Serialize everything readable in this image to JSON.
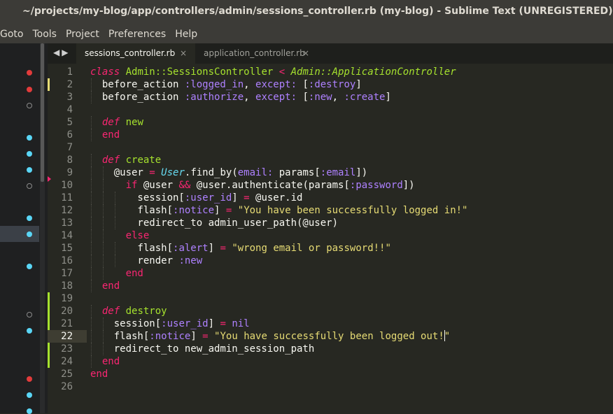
{
  "window": {
    "title": "~/projects/my-blog/app/controllers/admin/sessions_controller.rb (my-blog) - Sublime Text (UNREGISTERED)"
  },
  "menu": [
    "Goto",
    "Tools",
    "Project",
    "Preferences",
    "Help"
  ],
  "tabs": [
    {
      "label": "sessions_controller.rb",
      "active": true,
      "close": "×"
    },
    {
      "label": "application_controller.rb",
      "active": false,
      "close": "×"
    }
  ],
  "nav": {
    "back": "◀",
    "forward": "▶"
  },
  "editor": {
    "current_line": 22,
    "line_numbers": [
      "1",
      "2",
      "3",
      "4",
      "5",
      "6",
      "7",
      "8",
      "9",
      "10",
      "11",
      "12",
      "13",
      "14",
      "15",
      "16",
      "17",
      "18",
      "19",
      "20",
      "21",
      "22",
      "23",
      "24",
      "25",
      "26"
    ],
    "lines": [
      [
        [
          "kwi",
          "class"
        ],
        [
          "plain",
          " "
        ],
        [
          "cls",
          "Admin::SessionsController"
        ],
        [
          "plain",
          " "
        ],
        [
          "op",
          "<"
        ],
        [
          "plain",
          " "
        ],
        [
          "clsi",
          "Admin::ApplicationController"
        ]
      ],
      [
        [
          "plain",
          "  before_action "
        ],
        [
          "sym",
          ":logged_in"
        ],
        [
          "plain",
          ", "
        ],
        [
          "sym",
          "except:"
        ],
        [
          "plain",
          " ["
        ],
        [
          "sym",
          ":destroy"
        ],
        [
          "plain",
          "]"
        ]
      ],
      [
        [
          "plain",
          "  before_action "
        ],
        [
          "sym",
          ":authorize"
        ],
        [
          "plain",
          ", "
        ],
        [
          "sym",
          "except:"
        ],
        [
          "plain",
          " ["
        ],
        [
          "sym",
          ":new"
        ],
        [
          "plain",
          ", "
        ],
        [
          "sym",
          ":create"
        ],
        [
          "plain",
          "]"
        ]
      ],
      [
        [
          "plain",
          ""
        ]
      ],
      [
        [
          "plain",
          "  "
        ],
        [
          "kwi",
          "def"
        ],
        [
          "plain",
          " "
        ],
        [
          "fn",
          "new"
        ]
      ],
      [
        [
          "plain",
          "  "
        ],
        [
          "kw",
          "end"
        ]
      ],
      [
        [
          "plain",
          ""
        ]
      ],
      [
        [
          "plain",
          "  "
        ],
        [
          "kwi",
          "def"
        ],
        [
          "plain",
          " "
        ],
        [
          "fn",
          "create"
        ]
      ],
      [
        [
          "plain",
          "    @user "
        ],
        [
          "op",
          "="
        ],
        [
          "plain",
          " "
        ],
        [
          "ty",
          "User"
        ],
        [
          "plain",
          ".find_by("
        ],
        [
          "sym",
          "email:"
        ],
        [
          "plain",
          " params["
        ],
        [
          "sym",
          ":email"
        ],
        [
          "plain",
          "])"
        ]
      ],
      [
        [
          "plain",
          "      "
        ],
        [
          "kw",
          "if"
        ],
        [
          "plain",
          " @user "
        ],
        [
          "op",
          "&&"
        ],
        [
          "plain",
          " @user.authenticate(params["
        ],
        [
          "sym",
          ":password"
        ],
        [
          "plain",
          "])"
        ]
      ],
      [
        [
          "plain",
          "        session["
        ],
        [
          "sym",
          ":user_id"
        ],
        [
          "plain",
          "] "
        ],
        [
          "op",
          "="
        ],
        [
          "plain",
          " @user.id"
        ]
      ],
      [
        [
          "plain",
          "        flash["
        ],
        [
          "sym",
          ":notice"
        ],
        [
          "plain",
          "] "
        ],
        [
          "op",
          "="
        ],
        [
          "plain",
          " "
        ],
        [
          "str",
          "\"You have been successfully logged in!\""
        ]
      ],
      [
        [
          "plain",
          "        redirect_to admin_user_path(@user)"
        ]
      ],
      [
        [
          "plain",
          "      "
        ],
        [
          "kw",
          "else"
        ]
      ],
      [
        [
          "plain",
          "        flash["
        ],
        [
          "sym",
          ":alert"
        ],
        [
          "plain",
          "] "
        ],
        [
          "op",
          "="
        ],
        [
          "plain",
          " "
        ],
        [
          "str",
          "\"wrong email or password!!\""
        ]
      ],
      [
        [
          "plain",
          "        render "
        ],
        [
          "sym",
          ":new"
        ]
      ],
      [
        [
          "plain",
          "      "
        ],
        [
          "kw",
          "end"
        ]
      ],
      [
        [
          "plain",
          "  "
        ],
        [
          "kw",
          "end"
        ]
      ],
      [
        [
          "plain",
          ""
        ]
      ],
      [
        [
          "plain",
          "  "
        ],
        [
          "kwi",
          "def"
        ],
        [
          "plain",
          " "
        ],
        [
          "fn",
          "destroy"
        ]
      ],
      [
        [
          "plain",
          "    session["
        ],
        [
          "sym",
          ":user_id"
        ],
        [
          "plain",
          "] "
        ],
        [
          "op",
          "="
        ],
        [
          "plain",
          " "
        ],
        [
          "nil",
          "nil"
        ]
      ],
      [
        [
          "plain",
          "    flash["
        ],
        [
          "sym",
          ":notice"
        ],
        [
          "plain",
          "] "
        ],
        [
          "op",
          "="
        ],
        [
          "plain",
          " "
        ],
        [
          "str",
          "\"You have successfully been logged out!"
        ],
        [
          "cursor",
          ""
        ],
        [
          "str",
          "\""
        ]
      ],
      [
        [
          "plain",
          "    redirect_to new_admin_session_path"
        ]
      ],
      [
        [
          "plain",
          "  "
        ],
        [
          "kw",
          "end"
        ]
      ],
      [
        [
          "kw",
          "end"
        ]
      ],
      [
        [
          "plain",
          ""
        ]
      ]
    ]
  },
  "colors": {
    "background": "#272822",
    "keyword": "#f92672",
    "class_name": "#a6e22e",
    "symbol": "#ae81ff",
    "string": "#e6db74",
    "type": "#66d9ef"
  }
}
